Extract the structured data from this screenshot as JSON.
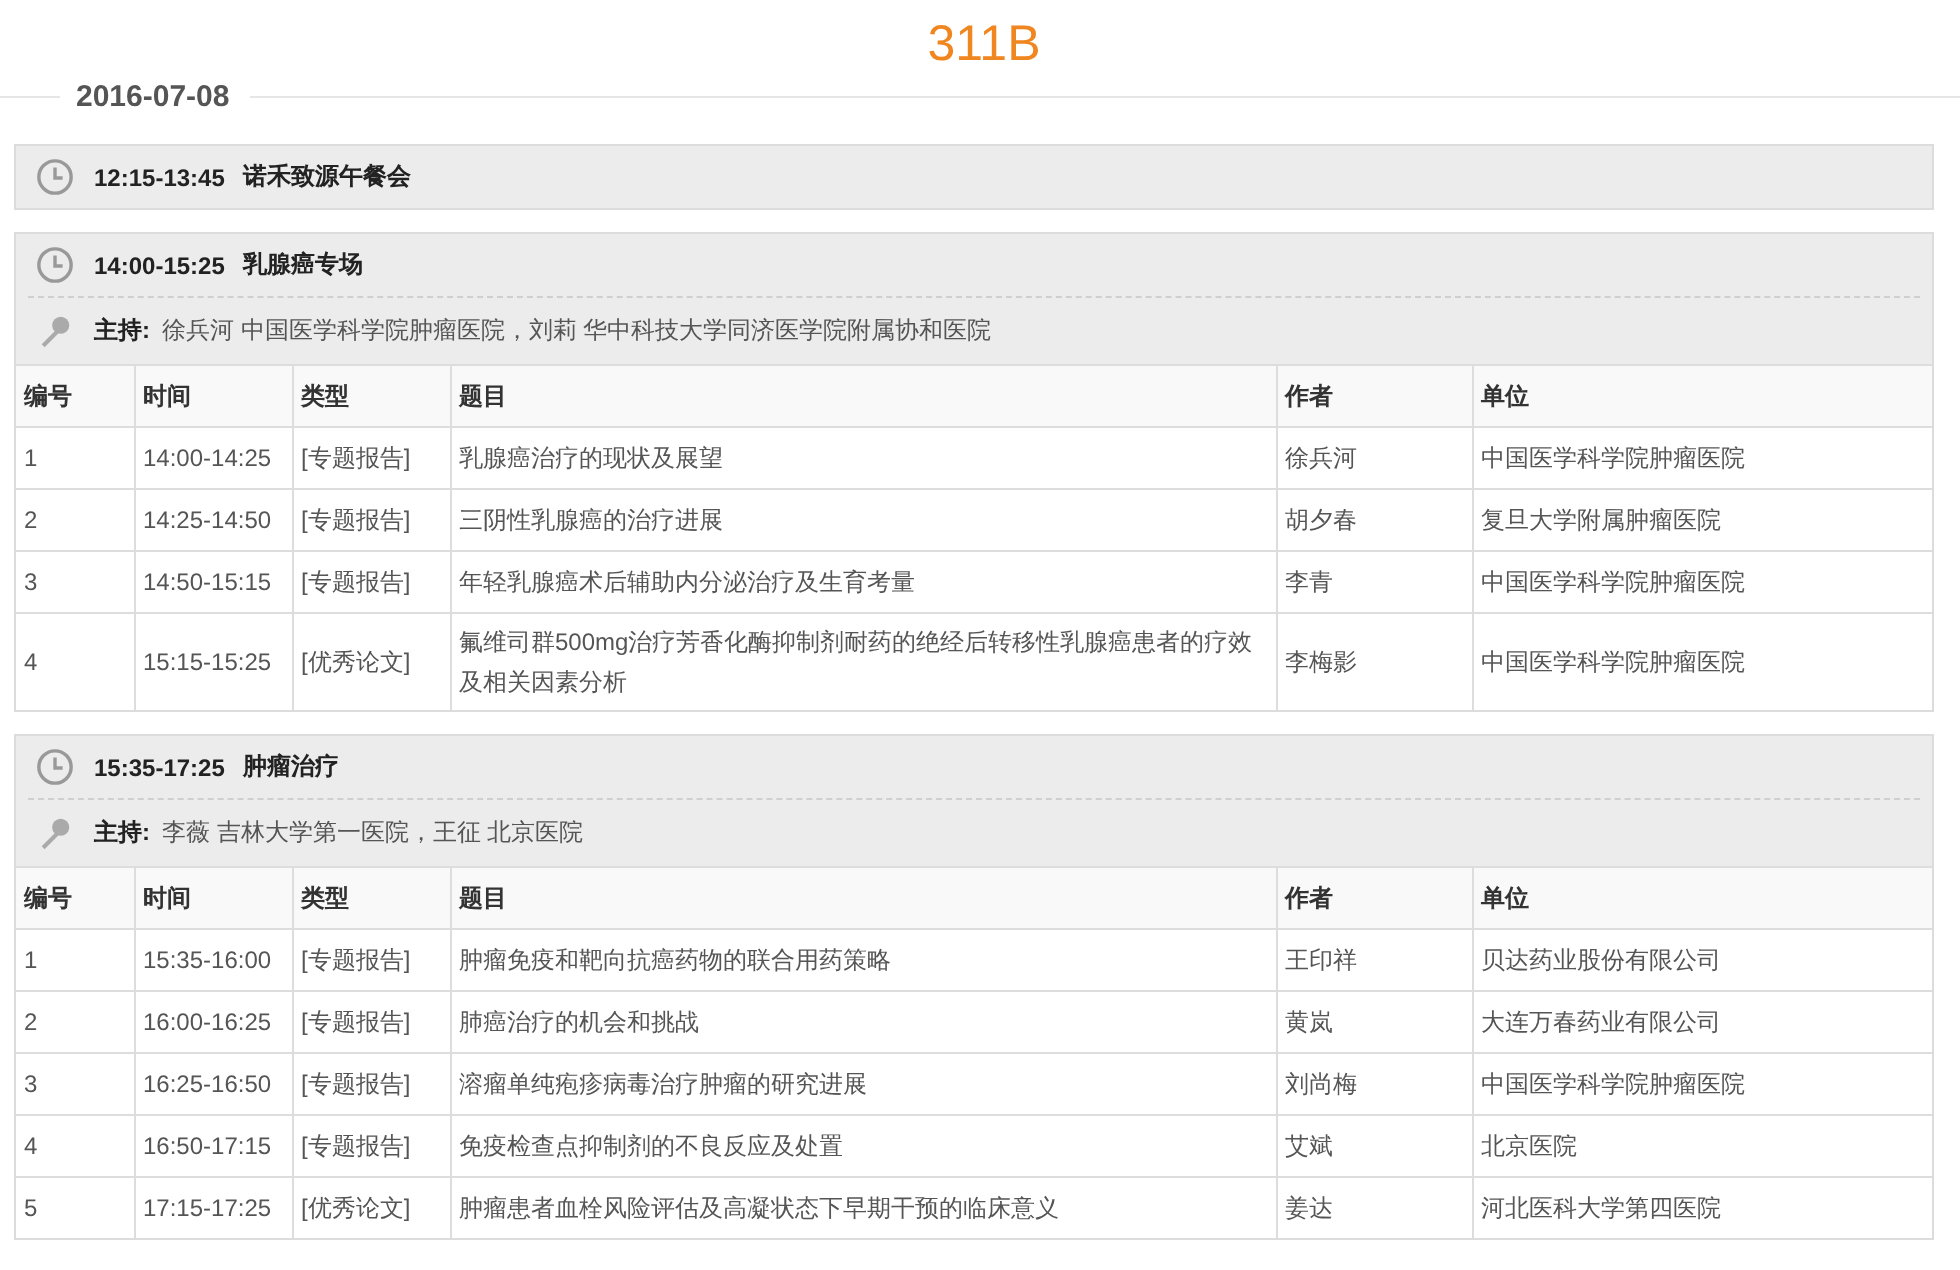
{
  "title": "311B",
  "date": "2016-07-08",
  "sessions": [
    {
      "time": "12:15-13:45",
      "name": "诺禾致源午餐会"
    },
    {
      "time": "14:00-15:25",
      "name": "乳腺癌专场",
      "host": {
        "label": "主持:",
        "text": "徐兵河 中国医学科学院肿瘤医院，刘莉 华中科技大学同济医学院附属协和医院"
      },
      "table": {
        "columns": [
          "编号",
          "时间",
          "类型",
          "题目",
          "作者",
          "单位"
        ],
        "rows": [
          [
            "1",
            "14:00-14:25",
            "[专题报告]",
            "乳腺癌治疗的现状及展望",
            "徐兵河",
            "中国医学科学院肿瘤医院"
          ],
          [
            "2",
            "14:25-14:50",
            "[专题报告]",
            "三阴性乳腺癌的治疗进展",
            "胡夕春",
            "复旦大学附属肿瘤医院"
          ],
          [
            "3",
            "14:50-15:15",
            "[专题报告]",
            "年轻乳腺癌术后辅助内分泌治疗及生育考量",
            "李青",
            "中国医学科学院肿瘤医院"
          ],
          [
            "4",
            "15:15-15:25",
            "[优秀论文]",
            "氟维司群500mg治疗芳香化酶抑制剂耐药的绝经后转移性乳腺癌患者的疗效及相关因素分析",
            "李梅影",
            "中国医学科学院肿瘤医院"
          ]
        ]
      }
    },
    {
      "time": "15:35-17:25",
      "name": "肿瘤治疗",
      "host": {
        "label": "主持:",
        "text": "李薇 吉林大学第一医院，王征 北京医院"
      },
      "table": {
        "columns": [
          "编号",
          "时间",
          "类型",
          "题目",
          "作者",
          "单位"
        ],
        "rows": [
          [
            "1",
            "15:35-16:00",
            "[专题报告]",
            "肿瘤免疫和靶向抗癌药物的联合用药策略",
            "王印祥",
            "贝达药业股份有限公司"
          ],
          [
            "2",
            "16:00-16:25",
            "[专题报告]",
            "肺癌治疗的机会和挑战",
            "黄岚",
            "大连万春药业有限公司"
          ],
          [
            "3",
            "16:25-16:50",
            "[专题报告]",
            "溶瘤单纯疱疹病毒治疗肿瘤的研究进展",
            "刘尚梅",
            "中国医学科学院肿瘤医院"
          ],
          [
            "4",
            "16:50-17:15",
            "[专题报告]",
            "免疫检查点抑制剂的不良反应及处置",
            "艾斌",
            "北京医院"
          ],
          [
            "5",
            "17:15-17:25",
            "[优秀论文]",
            "肿瘤患者血栓风险评估及高凝状态下早期干预的临床意义",
            "姜达",
            "河北医科大学第四医院"
          ]
        ]
      }
    }
  ]
}
